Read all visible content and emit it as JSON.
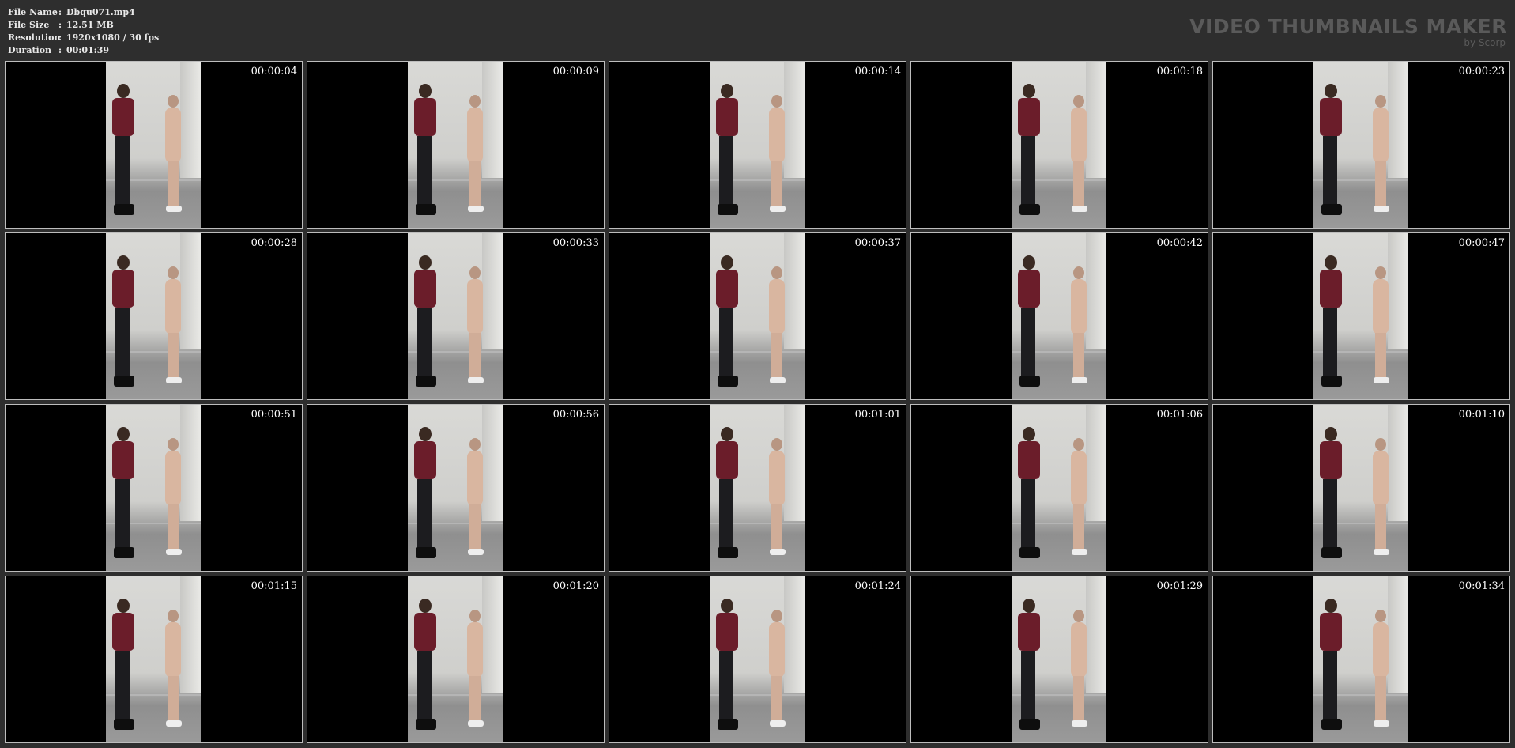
{
  "info": {
    "rows": [
      {
        "key": "File Name",
        "sep": ":",
        "value": "Dbqu071.mp4"
      },
      {
        "key": "File Size",
        "sep": ":",
        "value": "12.51 MB"
      },
      {
        "key": "Resolution",
        "sep": ":",
        "value": "1920x1080 / 30 fps"
      },
      {
        "key": "Duration",
        "sep": ":",
        "value": "00:01:39"
      }
    ]
  },
  "brand": {
    "title": "VIDEO THUMBNAILS MAKER",
    "subtitle": "by Scorp"
  },
  "thumbnails": [
    {
      "timestamp": "00:00:04"
    },
    {
      "timestamp": "00:00:09"
    },
    {
      "timestamp": "00:00:14"
    },
    {
      "timestamp": "00:00:18"
    },
    {
      "timestamp": "00:00:23"
    },
    {
      "timestamp": "00:00:28"
    },
    {
      "timestamp": "00:00:33"
    },
    {
      "timestamp": "00:00:37"
    },
    {
      "timestamp": "00:00:42"
    },
    {
      "timestamp": "00:00:47"
    },
    {
      "timestamp": "00:00:51"
    },
    {
      "timestamp": "00:00:56"
    },
    {
      "timestamp": "00:01:01"
    },
    {
      "timestamp": "00:01:06"
    },
    {
      "timestamp": "00:01:10"
    },
    {
      "timestamp": "00:01:15"
    },
    {
      "timestamp": "00:01:20"
    },
    {
      "timestamp": "00:01:24"
    },
    {
      "timestamp": "00:01:29"
    },
    {
      "timestamp": "00:01:34"
    }
  ]
}
